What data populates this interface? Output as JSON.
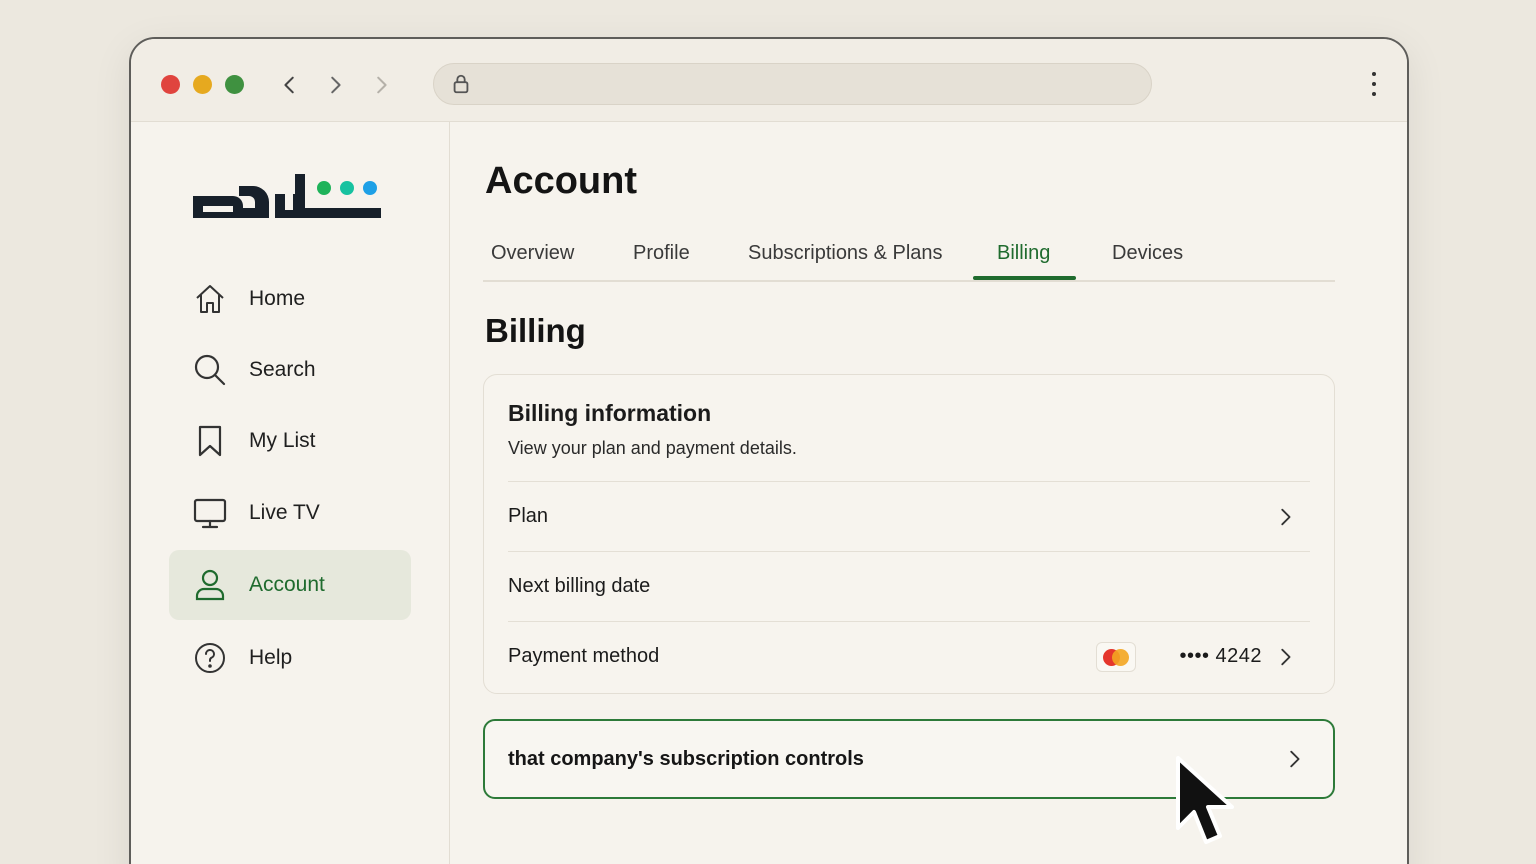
{
  "browser": {
    "url": "",
    "icons": {
      "back": "chevron-left-icon",
      "forward": "chevron-right-icon",
      "lock": "lock-icon",
      "menu": "kebab-menu-icon"
    }
  },
  "sidebar": {
    "logo_text": "شاهد",
    "logo_dot_colors": [
      "#1fb35a",
      "#17c2a0",
      "#1ea0e6"
    ],
    "items": [
      {
        "label": "Home",
        "icon": "home-icon"
      },
      {
        "label": "Search",
        "icon": "search-icon"
      },
      {
        "label": "My List",
        "icon": "bookmark-icon"
      },
      {
        "label": "Live TV",
        "icon": "tv-icon"
      },
      {
        "label": "Account",
        "icon": "user-icon",
        "active": true
      },
      {
        "label": "Help",
        "icon": "help-icon"
      }
    ]
  },
  "main": {
    "title": "Account",
    "tabs": [
      {
        "label": "Overview"
      },
      {
        "label": "Profile"
      },
      {
        "label": "Subscriptions & Plans"
      },
      {
        "label": "Billing",
        "active": true
      },
      {
        "label": "Devices"
      }
    ],
    "section_title": "Billing",
    "billing_card": {
      "title": "Billing information",
      "subtitle": "View your plan and payment details.",
      "rows": [
        {
          "label": "Plan"
        },
        {
          "label": "Next billing date"
        },
        {
          "label": "Payment method",
          "card_brand": "mastercard",
          "card_masked": "•••• 4242"
        }
      ]
    },
    "cta": {
      "label": "that company's subscription controls"
    }
  },
  "colors": {
    "accent": "#1f6b2e",
    "background": "#f6f3ed",
    "page": "#ece8df"
  }
}
